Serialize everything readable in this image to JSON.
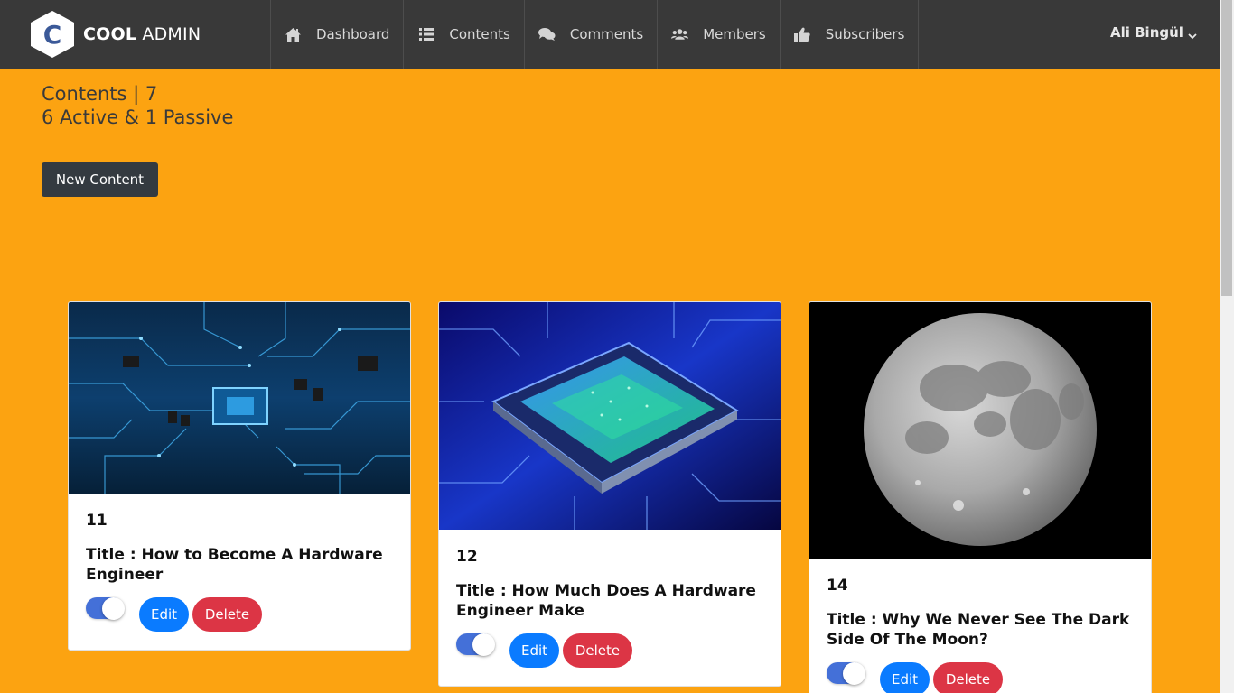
{
  "brand": {
    "logo_letter": "C",
    "name_bold": "COOL",
    "name_light": "ADMIN"
  },
  "nav": {
    "items": [
      {
        "label": "Dashboard",
        "icon": "home-icon"
      },
      {
        "label": "Contents",
        "icon": "list-icon"
      },
      {
        "label": "Comments",
        "icon": "comments-icon"
      },
      {
        "label": "Members",
        "icon": "users-icon"
      },
      {
        "label": "Subscribers",
        "icon": "thumbs-up-icon"
      }
    ]
  },
  "user": {
    "name": "Ali Bingül",
    "icon": "chevron-down-icon"
  },
  "page": {
    "title": "Contents | 7",
    "subtitle": "6 Active & 1 Passive",
    "new_button": "New Content"
  },
  "cards": [
    {
      "id": "11",
      "title": "Title : How to Become A Hardware Engineer",
      "active": true,
      "edit": "Edit",
      "delete": "Delete",
      "image": "circuit-board-image"
    },
    {
      "id": "12",
      "title": "Title : How Much Does A Hardware Engineer Make",
      "active": true,
      "edit": "Edit",
      "delete": "Delete",
      "image": "processor-chip-image"
    },
    {
      "id": "14",
      "title": "Title : Why We Never See The Dark Side Of The Moon?",
      "active": true,
      "edit": "Edit",
      "delete": "Delete",
      "image": "moon-image"
    }
  ],
  "colors": {
    "background": "#fca311",
    "topbar": "#393939",
    "edit": "#0a7bff",
    "delete": "#dc3545",
    "toggle": "#4470d8",
    "new_button": "#343a40"
  }
}
